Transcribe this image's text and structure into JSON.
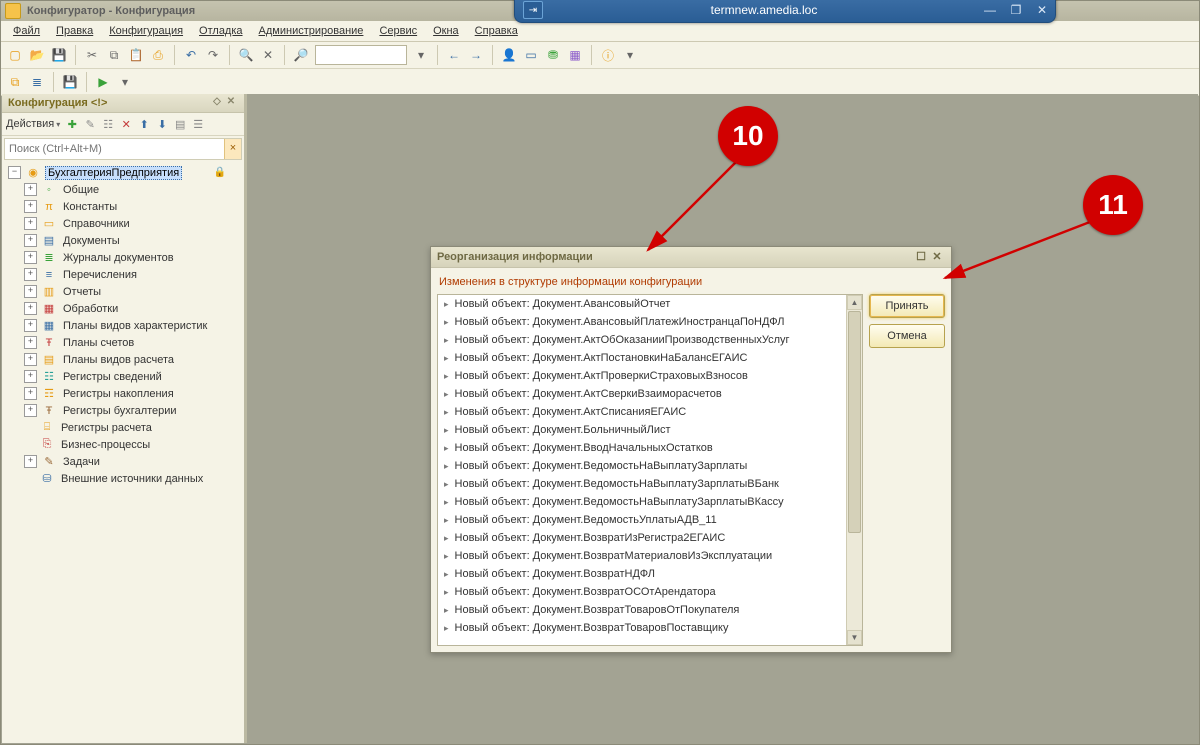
{
  "remote": {
    "title": "termnew.amedia.loc"
  },
  "app_title": "Конфигуратор - Конфигурация",
  "menu": {
    "file": "Файл",
    "edit": "Правка",
    "config": "Конфигурация",
    "debug": "Отладка",
    "admin": "Администрирование",
    "service": "Сервис",
    "windows": "Окна",
    "help": "Справка"
  },
  "panel": {
    "title": "Конфигурация <!>",
    "actions_label": "Действия",
    "search_placeholder": "Поиск (Ctrl+Alt+M)"
  },
  "tree": {
    "root": "БухгалтерияПредприятия",
    "items": [
      {
        "label": "Общие",
        "icon": "◦",
        "cls": "c-green",
        "exp": "+"
      },
      {
        "label": "Константы",
        "icon": "π",
        "cls": "c-orange",
        "exp": "+"
      },
      {
        "label": "Справочники",
        "icon": "▭",
        "cls": "c-orange",
        "exp": "+"
      },
      {
        "label": "Документы",
        "icon": "▤",
        "cls": "c-blue",
        "exp": "+"
      },
      {
        "label": "Журналы документов",
        "icon": "≣",
        "cls": "c-green",
        "exp": "+"
      },
      {
        "label": "Перечисления",
        "icon": "≡",
        "cls": "c-blue",
        "exp": "+"
      },
      {
        "label": "Отчеты",
        "icon": "▥",
        "cls": "c-orange",
        "exp": "+"
      },
      {
        "label": "Обработки",
        "icon": "▦",
        "cls": "c-red",
        "exp": "+"
      },
      {
        "label": "Планы видов характеристик",
        "icon": "▦",
        "cls": "c-blue",
        "exp": "+"
      },
      {
        "label": "Планы счетов",
        "icon": "Ŧ",
        "cls": "c-red",
        "exp": "+"
      },
      {
        "label": "Планы видов расчета",
        "icon": "▤",
        "cls": "c-orange",
        "exp": "+"
      },
      {
        "label": "Регистры сведений",
        "icon": "☷",
        "cls": "c-teal",
        "exp": "+"
      },
      {
        "label": "Регистры накопления",
        "icon": "☶",
        "cls": "c-orange",
        "exp": "+"
      },
      {
        "label": "Регистры бухгалтерии",
        "icon": "Ŧ",
        "cls": "c-brown",
        "exp": "+"
      },
      {
        "label": "Регистры расчета",
        "icon": "⌸",
        "cls": "c-orange",
        "exp": ""
      },
      {
        "label": "Бизнес-процессы",
        "icon": "⎘",
        "cls": "c-red",
        "exp": ""
      },
      {
        "label": "Задачи",
        "icon": "✎",
        "cls": "c-brown",
        "exp": "+"
      },
      {
        "label": "Внешние источники данных",
        "icon": "⛁",
        "cls": "c-blue",
        "exp": ""
      }
    ]
  },
  "dialog": {
    "title": "Реорганизация информации",
    "info": "Изменения в структуре информации конфигурации",
    "accept": "Принять",
    "cancel": "Отмена",
    "items": [
      "Новый объект: Документ.АвансовыйОтчет",
      "Новый объект: Документ.АвансовыйПлатежИностранцаПоНДФЛ",
      "Новый объект: Документ.АктОбОказанииПроизводственныхУслуг",
      "Новый объект: Документ.АктПостановкиНаБалансЕГАИС",
      "Новый объект: Документ.АктПроверкиСтраховыхВзносов",
      "Новый объект: Документ.АктСверкиВзаиморасчетов",
      "Новый объект: Документ.АктСписанияЕГАИС",
      "Новый объект: Документ.БольничныйЛист",
      "Новый объект: Документ.ВводНачальныхОстатков",
      "Новый объект: Документ.ВедомостьНаВыплатуЗарплаты",
      "Новый объект: Документ.ВедомостьНаВыплатуЗарплатыВБанк",
      "Новый объект: Документ.ВедомостьНаВыплатуЗарплатыВКассу",
      "Новый объект: Документ.ВедомостьУплатыАДВ_11",
      "Новый объект: Документ.ВозвратИзРегистра2ЕГАИС",
      "Новый объект: Документ.ВозвратМатериаловИзЭксплуатации",
      "Новый объект: Документ.ВозвратНДФЛ",
      "Новый объект: Документ.ВозвратОСОтАрендатора",
      "Новый объект: Документ.ВозвратТоваровОтПокупателя",
      "Новый объект: Документ.ВозвратТоваровПоставщику"
    ]
  },
  "annotations": {
    "b10": "10",
    "b11": "11"
  }
}
